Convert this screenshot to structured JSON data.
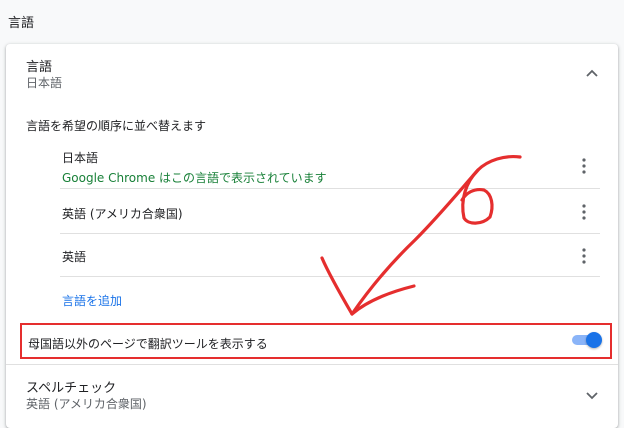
{
  "section_title": "言語",
  "language_header": {
    "title": "言語",
    "subtitle": "日本語"
  },
  "reorder_label": "言語を希望の順序に並べ替えます",
  "languages": [
    {
      "name": "日本語",
      "note": "Google Chrome はこの言語で表示されています"
    },
    {
      "name": "英語 (アメリカ合衆国)"
    },
    {
      "name": "英語"
    }
  ],
  "add_language": "言語を追加",
  "translate_setting": {
    "label": "母国語以外のページで翻訳ツールを表示する",
    "enabled": true
  },
  "spellcheck": {
    "title": "スペルチェック",
    "subtitle": "英語 (アメリカ合衆国)"
  },
  "colors": {
    "accent": "#1a73e8",
    "success_text": "#188038",
    "annotation": "#e52e2e"
  },
  "icons": [
    "chevron-up-icon",
    "more-vert-icon",
    "chevron-down-icon"
  ]
}
